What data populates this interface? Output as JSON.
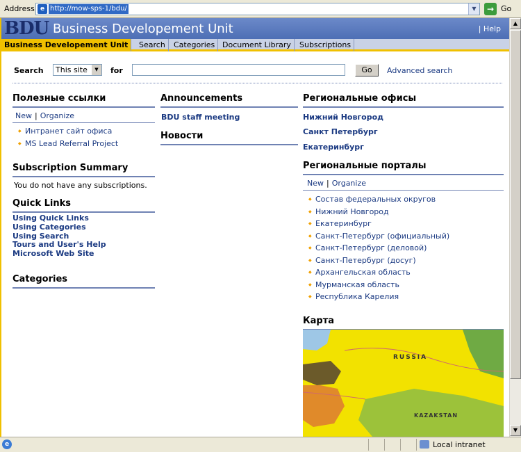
{
  "browser": {
    "address_label": "Address",
    "url": "http://mow-sps-1/bdu/",
    "go_label": "Go",
    "status_zone": "Local intranet"
  },
  "site": {
    "logo": "BDU",
    "title": "Business Developement Unit",
    "help_label": "Help"
  },
  "nav": {
    "tabs": [
      {
        "label": "Business Developement Unit"
      },
      {
        "label": "Search"
      },
      {
        "label": "Categories"
      },
      {
        "label": "Document Library"
      },
      {
        "label": "Subscriptions"
      }
    ]
  },
  "search": {
    "label": "Search",
    "scope_value": "This site",
    "for_label": "for",
    "query_value": "",
    "button_label": "Go",
    "advanced_label": "Advanced search"
  },
  "useful_links": {
    "title": "Полезные ссылки",
    "toolbar": {
      "new": "New",
      "organize": "Organize"
    },
    "items": [
      "Интранет сайт офиса",
      "MS Lead Referral Project"
    ]
  },
  "subscription_summary": {
    "title": "Subscription Summary",
    "text": "You do not have any subscriptions."
  },
  "quick_links": {
    "title": "Quick Links",
    "items": [
      "Using Quick Links",
      "Using Categories",
      "Using Search",
      "Tours and User's Help",
      "Microsoft Web Site"
    ]
  },
  "categories": {
    "title": "Categories"
  },
  "announcements": {
    "title": "Announcements",
    "items": [
      "BDU staff meeting"
    ]
  },
  "news": {
    "title": "Новости"
  },
  "regional_offices": {
    "title": "Региональные офисы",
    "items": [
      "Нижний Новгород",
      "Санкт Петербург",
      "Екатеринбург"
    ]
  },
  "regional_portals": {
    "title": "Региональные порталы",
    "toolbar": {
      "new": "New",
      "organize": "Organize"
    },
    "items": [
      "Состав федеральных округов",
      "Нижний Новгород",
      "Екатеринбург",
      "Санкт-Петербург (официальный)",
      "Санкт-Петербург (деловой)",
      "Санкт-Петербург (досуг)",
      "Архангельская область",
      "Мурманская область",
      "Республика Карелия"
    ]
  },
  "map": {
    "title": "Карта",
    "labels": {
      "russia": "RUSSIA",
      "kazakhstan": "KAZAKSTAN"
    },
    "colors": {
      "russia": "#f2e200",
      "kazakhstan": "#9cc23a",
      "belarus": "#6b5a2a",
      "ukraine": "#e08a2a",
      "sea": "#9ec7e6",
      "east": "#6faa44"
    }
  }
}
